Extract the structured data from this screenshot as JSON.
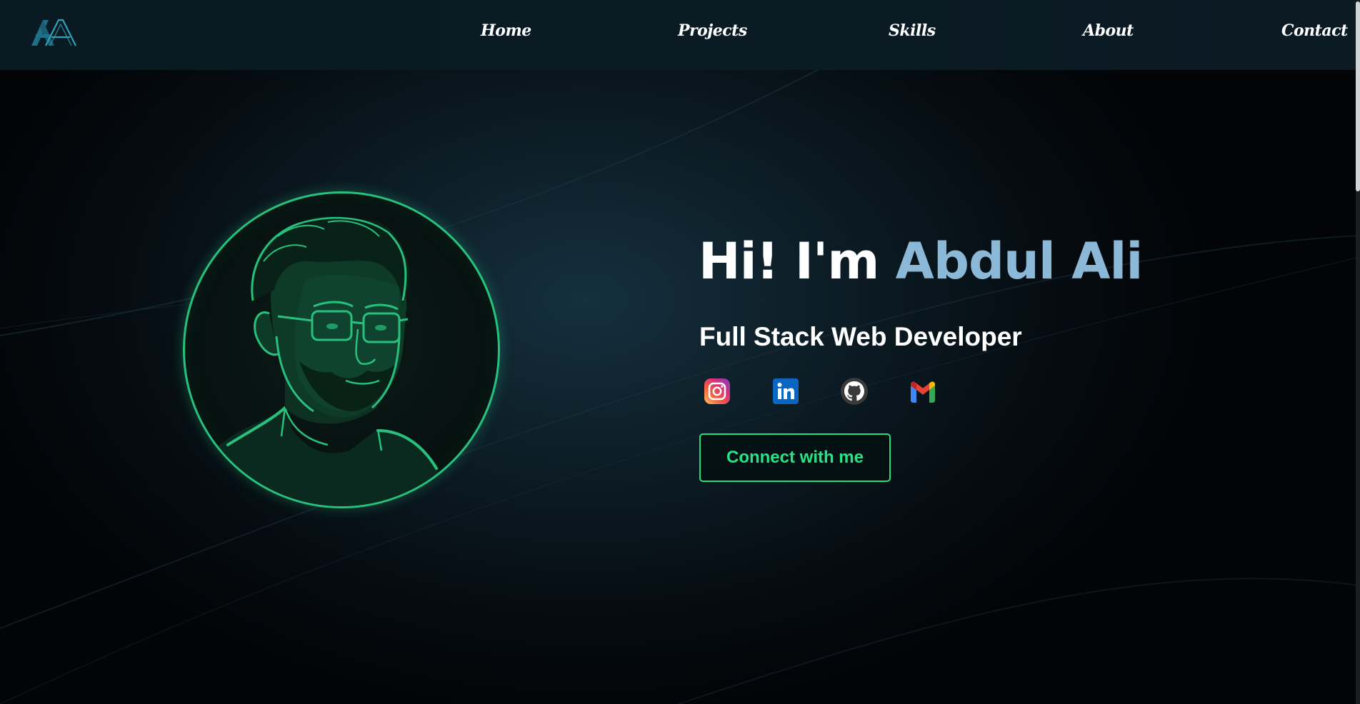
{
  "nav": {
    "logo_text": "AA",
    "links": [
      "Home",
      "Projects",
      "Skills",
      "About",
      "Contact"
    ]
  },
  "hero": {
    "greeting": "Hi! I'm ",
    "name": "Abdul Ali",
    "role": "Full Stack Web Developer",
    "cta_label": "Connect with me",
    "avatar_icon": "developer-portrait-illustration"
  },
  "socials": [
    {
      "name": "Instagram",
      "icon": "instagram-icon"
    },
    {
      "name": "LinkedIn",
      "icon": "linkedin-icon"
    },
    {
      "name": "GitHub",
      "icon": "github-icon"
    },
    {
      "name": "Gmail",
      "icon": "gmail-icon"
    }
  ],
  "colors": {
    "accent_green": "#22e584",
    "avatar_ring": "#27c17e",
    "name_blue": "#8bb8d6",
    "navbar_bg": "#0b1b24"
  }
}
